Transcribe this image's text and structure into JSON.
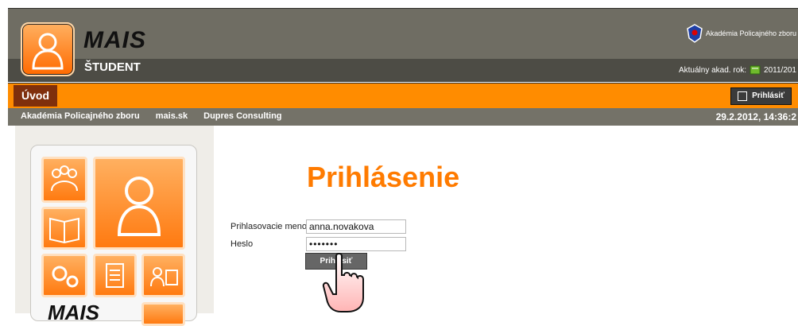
{
  "header": {
    "brand": "MAIS",
    "subtitle": "ŠTUDENT",
    "institution": "Akadémia Policajného zboru",
    "academic_year_label": "Aktuálny akad. rok:",
    "academic_year_value": "2011/201"
  },
  "nav": {
    "tab_home": "Úvod",
    "login_button": "Prihlásiť"
  },
  "links": [
    "Akadémia Policajného zboru",
    "mais.sk",
    "Dupres Consulting"
  ],
  "datetime": "29.2.2012,  14:36:2",
  "sidebar": {
    "brand_bottom": "MAIS"
  },
  "login_form": {
    "title": "Prihlásenie",
    "username_label": "Prihlasovacie meno",
    "username_value": "anna.novakova",
    "password_label": "Heslo",
    "password_masked": "•••••••",
    "submit_label": "Prihlásiť"
  },
  "colors": {
    "accent": "#ff8c00",
    "header_dark": "#4d4c45",
    "header": "#6f6d63",
    "tab_active": "#7f2f0c"
  },
  "icons": [
    "student-avatar-icon",
    "group-icon",
    "book-icon",
    "gears-icon",
    "document-icon",
    "person-card-icon",
    "calendar-icon",
    "hand-cursor-icon",
    "police-badge-icon"
  ]
}
